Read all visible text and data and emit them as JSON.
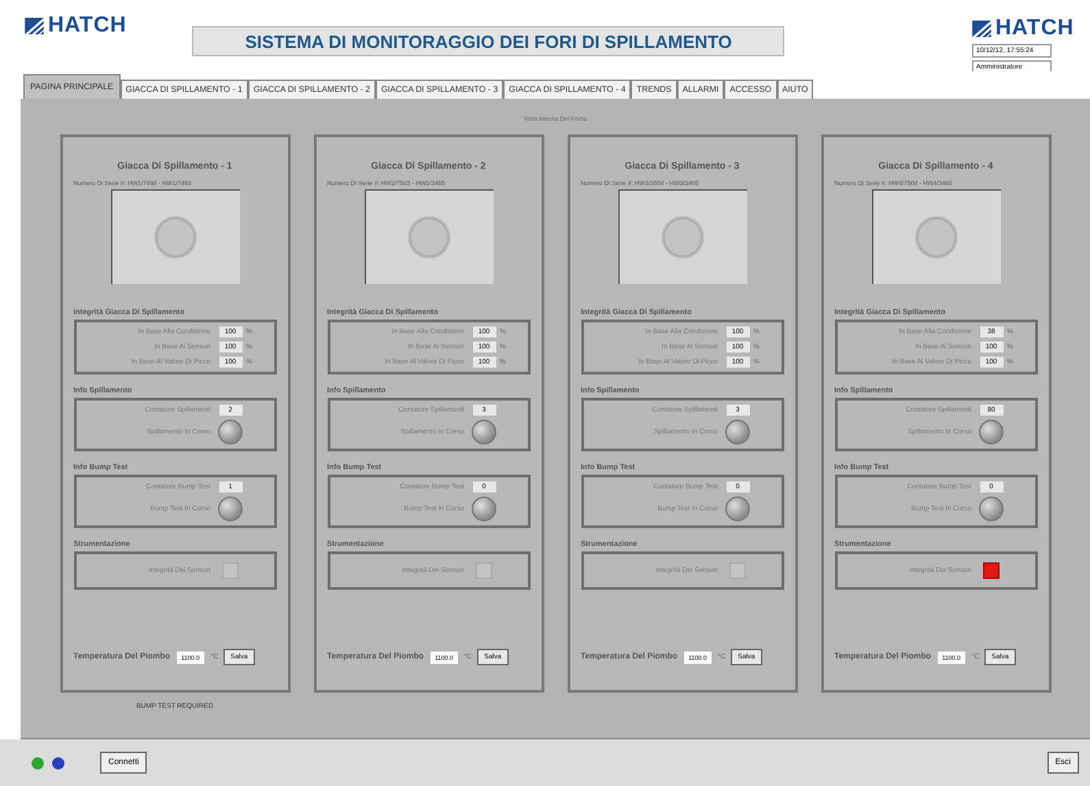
{
  "header": {
    "logo_left": "HATCH",
    "title": "SISTEMA DI MONITORAGGIO DEI FORI DI SPILLAMENTO",
    "logo_right": "HATCH",
    "datetime": "10/12/12, 17:55:24",
    "user": "Amministratore"
  },
  "tabs": [
    {
      "label": "PAGINA PRINCIPALE",
      "selected": true
    },
    {
      "label": "GIACCA DI SPILLAMENTO - 1",
      "selected": false
    },
    {
      "label": "GIACCA DI SPILLAMENTO - 2",
      "selected": false
    },
    {
      "label": "GIACCA DI SPILLAMENTO - 3",
      "selected": false
    },
    {
      "label": "GIACCA DI SPILLAMENTO - 4",
      "selected": false
    },
    {
      "label": "TRENDS",
      "selected": false
    },
    {
      "label": "ALLARMI",
      "selected": false
    },
    {
      "label": "ACCESSO",
      "selected": false
    },
    {
      "label": "AIUTO",
      "selected": false
    }
  ],
  "view_caption": "Vista Interna Del Forno",
  "jackets": [
    {
      "title": "Giacca Di Spillamento - 1",
      "serial": "Numero Di Serie #: HW1/7498 - HW1/7493",
      "integrity_heading": "Integrità Giacca Di Spillamento",
      "integrity": [
        {
          "label": "In Base Alla Condizione",
          "value": "100",
          "unit": "%"
        },
        {
          "label": "In Base Ai Sensori",
          "value": "100",
          "unit": "%"
        },
        {
          "label": "In Base Al Valore Di Picco",
          "value": "100",
          "unit": "%"
        }
      ],
      "tapping_heading": "Info Spillamento",
      "tap_counter_label": "Contatore Spillamenti",
      "tap_counter": "2",
      "tap_active_label": "Spillamento In Corso",
      "tap_active": false,
      "bump_heading": "Info Bump Test",
      "bump_counter_label": "Contatore Bump Test",
      "bump_counter": "1",
      "bump_active_label": "Bump Test In Corso",
      "bump_active": false,
      "instr_heading": "Strumentazione",
      "sensor_label": "Integrità Dei Sensori",
      "sensor_alarm": false,
      "temp_label": "Temperatura Del Piombo",
      "temp_value": "1100.0",
      "temp_unit": "°C",
      "save_button": "Salva",
      "note": "BUMP TEST REQUIRED"
    },
    {
      "title": "Giacca Di Spillamento - 2",
      "serial": "Numero Di Serie #: HW2/7503 - HW2/3465",
      "integrity_heading": "Integrità Giacca Di Spillamento",
      "integrity": [
        {
          "label": "In Base Alla Condizione",
          "value": "100",
          "unit": "%"
        },
        {
          "label": "In Base Ai Sensori",
          "value": "100",
          "unit": "%"
        },
        {
          "label": "In Base Al Valore Di Picco",
          "value": "100",
          "unit": "%"
        }
      ],
      "tapping_heading": "Info Spillamento",
      "tap_counter_label": "Contatore Spillamenti",
      "tap_counter": "3",
      "tap_active_label": "Spillamento In Corso",
      "tap_active": false,
      "bump_heading": "Info Bump Test",
      "bump_counter_label": "Contatore Bump Test",
      "bump_counter": "0",
      "bump_active_label": "Bump Test In Corso",
      "bump_active": false,
      "instr_heading": "Strumentazione",
      "sensor_label": "Integrità Dei Sensori",
      "sensor_alarm": false,
      "temp_label": "Temperatura Del Piombo",
      "temp_value": "1100.0",
      "temp_unit": "°C",
      "save_button": "Salva"
    },
    {
      "title": "Giacca Di Spillamento - 3",
      "serial": "Numero Di Serie #: HW3/3504 - HW3/3465",
      "integrity_heading": "Integrità Giacca Di Spillamento",
      "integrity": [
        {
          "label": "In Base Alla Condizione",
          "value": "100",
          "unit": "%"
        },
        {
          "label": "In Base Ai Sensori",
          "value": "100",
          "unit": "%"
        },
        {
          "label": "In Base Al Valore Di Picco",
          "value": "100",
          "unit": "%"
        }
      ],
      "tapping_heading": "Info Spillamento",
      "tap_counter_label": "Contatore Spillamenti",
      "tap_counter": "3",
      "tap_active_label": "Spillamento In Corso",
      "tap_active": false,
      "bump_heading": "Info Bump Test",
      "bump_counter_label": "Contatore Bump Test",
      "bump_counter": "0",
      "bump_active_label": "Bump Test In Corso",
      "bump_active": false,
      "instr_heading": "Strumentazione",
      "sensor_label": "Integrità Dei Sensori",
      "sensor_alarm": false,
      "temp_label": "Temperatura Del Piombo",
      "temp_value": "1100.0",
      "temp_unit": "°C",
      "save_button": "Salva"
    },
    {
      "title": "Giacca Di Spillamento - 4",
      "serial": "Numero Di Serie #: HW4/7504 - HW4/3465",
      "integrity_heading": "Integrità Giacca Di Spillamento",
      "integrity": [
        {
          "label": "In Base Alla Condizione",
          "value": "38",
          "unit": "%"
        },
        {
          "label": "In Base Ai Sensori",
          "value": "100",
          "unit": "%"
        },
        {
          "label": "In Base Al Valore Di Picco",
          "value": "100",
          "unit": "%"
        }
      ],
      "tapping_heading": "Info Spillamento",
      "tap_counter_label": "Contatore Spillamenti",
      "tap_counter": "80",
      "tap_active_label": "Spillamento In Corso",
      "tap_active": false,
      "bump_heading": "Info Bump Test",
      "bump_counter_label": "Contatore Bump Test",
      "bump_counter": "0",
      "bump_active_label": "Bump Test In Corso",
      "bump_active": false,
      "instr_heading": "Strumentazione",
      "sensor_label": "Integrità Dei Sensori",
      "sensor_alarm": true,
      "temp_label": "Temperatura Del Piombo",
      "temp_value": "1100.0",
      "temp_unit": "°C",
      "save_button": "Salva"
    }
  ],
  "footer": {
    "lights": [
      {
        "color": "#2fa82f"
      },
      {
        "color": "#2a3fc0"
      }
    ],
    "connect_button": "Connetti",
    "exit_button": "Esci"
  }
}
